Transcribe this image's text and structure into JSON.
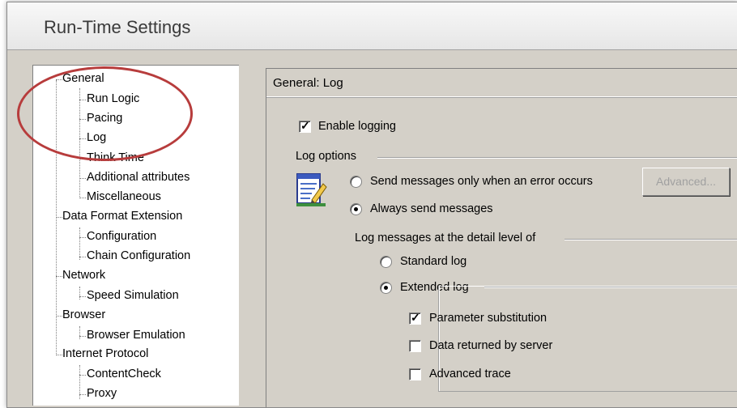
{
  "window": {
    "title": "Run-Time Settings"
  },
  "tree": {
    "items": [
      {
        "label": "General"
      },
      {
        "label": "Run Logic"
      },
      {
        "label": "Pacing"
      },
      {
        "label": "Log"
      },
      {
        "label": "Think Time"
      },
      {
        "label": "Additional attributes"
      },
      {
        "label": "Miscellaneous"
      },
      {
        "label": "Data Format Extension"
      },
      {
        "label": "Configuration"
      },
      {
        "label": "Chain Configuration"
      },
      {
        "label": "Network"
      },
      {
        "label": "Speed Simulation"
      },
      {
        "label": "Browser"
      },
      {
        "label": "Browser Emulation"
      },
      {
        "label": "Internet Protocol"
      },
      {
        "label": "ContentCheck"
      },
      {
        "label": "Proxy"
      }
    ],
    "selected": "Log",
    "highlight_color": "#b73c3c"
  },
  "panel": {
    "header": "General: Log",
    "enable_logging": {
      "label": "Enable logging",
      "checked": true
    },
    "log_options_label": "Log options",
    "send_only_on_error": {
      "label": "Send messages only when an error occurs",
      "selected": false
    },
    "always_send": {
      "label": "Always send messages",
      "selected": true
    },
    "advanced_button": "Advanced...",
    "detail_level_label": "Log messages at the detail level of",
    "standard_log": {
      "label": "Standard log",
      "selected": false
    },
    "extended_log": {
      "label": "Extended log",
      "selected": true
    },
    "parameter_substitution": {
      "label": "Parameter substitution",
      "checked": true
    },
    "data_returned": {
      "label": "Data returned by server",
      "checked": false
    },
    "advanced_trace": {
      "label": "Advanced trace",
      "checked": false
    }
  },
  "icons": {
    "log_options": "log-notepad-icon"
  }
}
